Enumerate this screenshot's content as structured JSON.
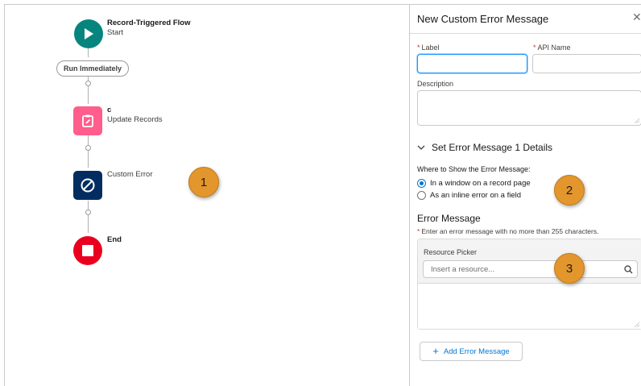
{
  "canvas": {
    "start_node": {
      "title": "Record-Triggered Flow",
      "subtitle": "Start",
      "color": "#06857f"
    },
    "run_pill": "Run Immediately",
    "update_node": {
      "title": "c",
      "subtitle": "Update Records",
      "color": "#ff5d8b"
    },
    "custom_error_node": {
      "title": "Custom Error",
      "color": "#032d60"
    },
    "end_node": {
      "title": "End",
      "color": "#ea001e"
    },
    "callouts": [
      "1",
      "2",
      "3"
    ]
  },
  "panel": {
    "title": "New Custom Error Message",
    "close_icon": "close-icon",
    "label_field": {
      "label": "Label",
      "value": ""
    },
    "api_name_field": {
      "label": "API Name",
      "value": ""
    },
    "description_field": {
      "label": "Description",
      "value": ""
    },
    "section_title": "Set Error Message 1 Details",
    "where_label": "Where to Show the Error Message:",
    "options": [
      {
        "label": "In a window on a record page",
        "selected": true
      },
      {
        "label": "As an inline error on a field",
        "selected": false
      }
    ],
    "error_heading": "Error Message",
    "error_hint": "Enter an error message with no more than 255 characters.",
    "resource_picker": {
      "label": "Resource Picker",
      "placeholder": "Insert a resource..."
    },
    "add_button": "Add Error Message"
  },
  "colors": {
    "accent": "#0176d3",
    "callout": "#e3962b",
    "required": "#c23934"
  }
}
